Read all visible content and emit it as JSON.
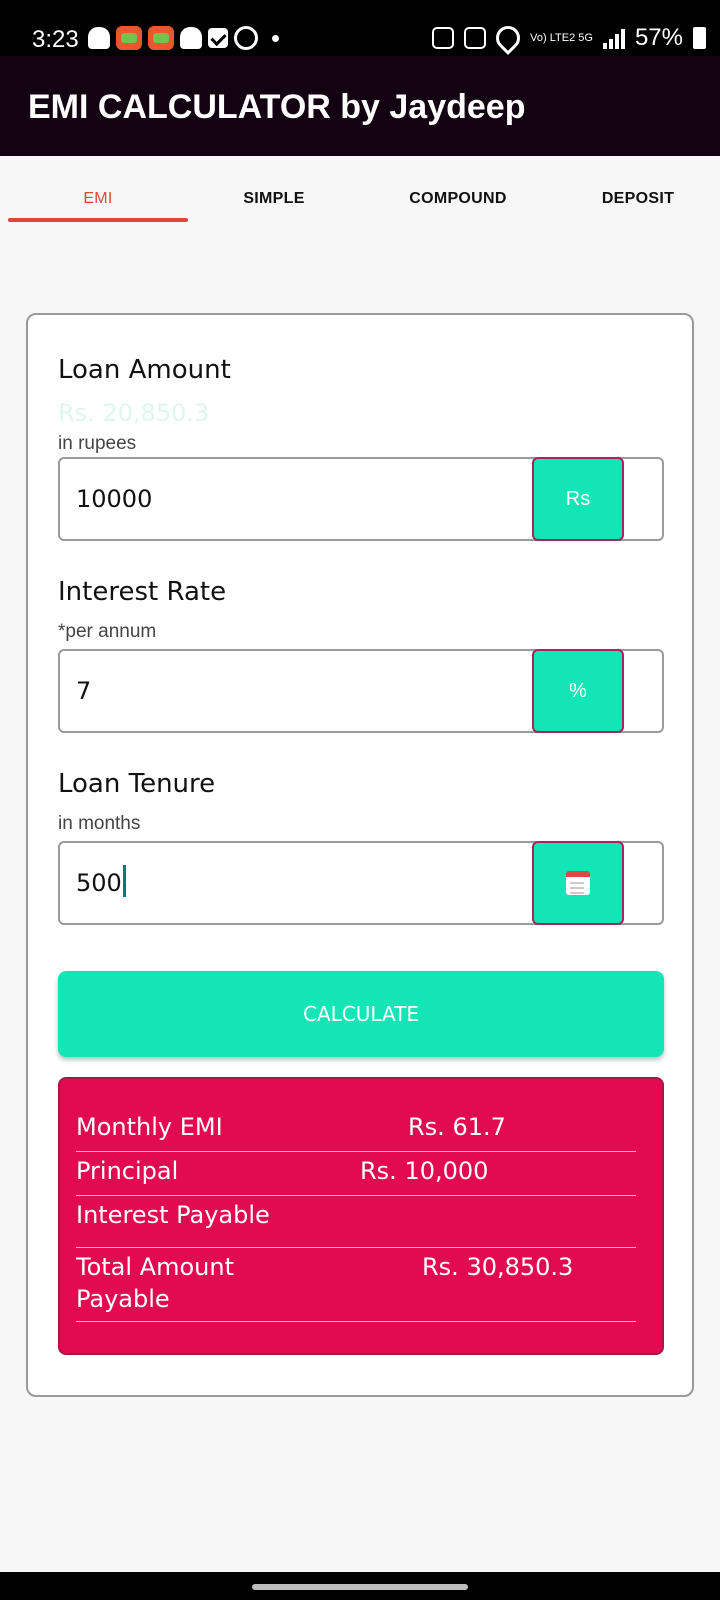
{
  "status_bar": {
    "time": "3:23",
    "battery": "57%",
    "network": "Vo) LTE2 5G"
  },
  "app_bar": {
    "title": "EMI CALCULATOR by Jaydeep"
  },
  "tabs": [
    {
      "label": "EMI",
      "active": true
    },
    {
      "label": "SIMPLE",
      "active": false
    },
    {
      "label": "COMPOUND",
      "active": false
    },
    {
      "label": "DEPOSIT",
      "active": false
    }
  ],
  "form": {
    "loan_amount": {
      "label": "Loan Amount",
      "ghost_value": "Rs. 20,850.3",
      "hint": "in rupees",
      "value": "10000",
      "unit": "Rs"
    },
    "interest_rate": {
      "label": "Interest Rate",
      "hint": "*per annum",
      "value": "7",
      "unit": "%"
    },
    "loan_tenure": {
      "label": "Loan Tenure",
      "hint": "in months",
      "value": "500",
      "unit_icon": "calendar-icon"
    },
    "calculate_label": "CALCULATE"
  },
  "results": {
    "monthly_emi": {
      "label": "Monthly EMI",
      "value": "Rs. 61.7"
    },
    "principal": {
      "label": "Principal",
      "value": "Rs. 10,000"
    },
    "interest_payable": {
      "label": "Interest Payable",
      "value": ""
    },
    "total_amount": {
      "label_line1": "Total Amount",
      "label_line2": "Payable",
      "value": "Rs. 30,850.3"
    }
  },
  "colors": {
    "accent": "#14e5b7",
    "result_bg": "#e20b52",
    "tab_active": "#e2463b",
    "app_bar": "#130312"
  }
}
